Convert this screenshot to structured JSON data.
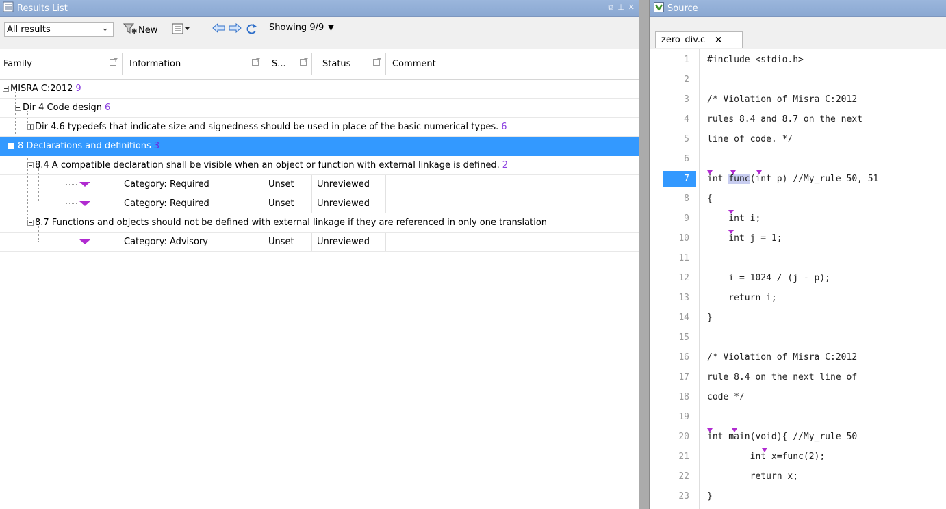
{
  "results_panel": {
    "title": "Results List",
    "window_controls": [
      "restore-icon",
      "pin-icon",
      "close-icon"
    ],
    "toolbar": {
      "filter_select_value": "All results",
      "new_label": "New",
      "showing_label": "Showing 9/9"
    },
    "columns": [
      "Family",
      "Information",
      "S...",
      "Status",
      "Comment"
    ],
    "tree": {
      "root": {
        "label": "MISRA C:2012",
        "count": "9"
      },
      "dir4": {
        "label": "Dir 4 Code design",
        "count": "6"
      },
      "dir46": {
        "label": "Dir 4.6 typedefs that indicate size and signedness should be used in place of the basic numerical types.",
        "count": "6"
      },
      "rule8": {
        "label": "8 Declarations and definitions",
        "count": "3"
      },
      "rule84": {
        "label": "8.4 A compatible declaration shall be visible when an object or function with external linkage is defined.",
        "count": "2"
      },
      "rule87": {
        "label": "8.7 Functions and objects should not be defined with external linkage if they are referenced in only one translation"
      },
      "leaves": [
        {
          "information": "Category: Required",
          "severity": "Unset",
          "status": "Unreviewed"
        },
        {
          "information": "Category: Required",
          "severity": "Unset",
          "status": "Unreviewed"
        },
        {
          "information": "Category: Advisory",
          "severity": "Unset",
          "status": "Unreviewed"
        }
      ]
    }
  },
  "source_panel": {
    "title": "Source",
    "tab_label": "zero_div.c",
    "tab_close": "×",
    "active_line": "7",
    "lines": [
      {
        "num": "1",
        "text": "#include <stdio.h>"
      },
      {
        "num": "2",
        "text": ""
      },
      {
        "num": "3",
        "text": "/* Violation of Misra C:2012"
      },
      {
        "num": "4",
        "text": "rules 8.4 and 8.7 on the next"
      },
      {
        "num": "5",
        "text": "line of code. */"
      },
      {
        "num": "6",
        "text": ""
      },
      {
        "num": "7",
        "pre": "int ",
        "hl": "func",
        "post": "(int p) //My_rule 50, 51"
      },
      {
        "num": "8",
        "text": "{"
      },
      {
        "num": "9",
        "text": "    int i;"
      },
      {
        "num": "10",
        "text": "    int j = 1;"
      },
      {
        "num": "11",
        "text": ""
      },
      {
        "num": "12",
        "text": "    i = 1024 / (j - p);"
      },
      {
        "num": "13",
        "text": "    return i;"
      },
      {
        "num": "14",
        "text": "}"
      },
      {
        "num": "15",
        "text": ""
      },
      {
        "num": "16",
        "text": "/* Violation of Misra C:2012"
      },
      {
        "num": "17",
        "text": "rule 8.4 on the next line of"
      },
      {
        "num": "18",
        "text": "code */"
      },
      {
        "num": "19",
        "text": ""
      },
      {
        "num": "20",
        "text": "int main(void){ //My_rule 50"
      },
      {
        "num": "21",
        "text": "        int x=func(2);"
      },
      {
        "num": "22",
        "text": "        return x;"
      },
      {
        "num": "23",
        "text": "}"
      }
    ]
  },
  "colors": {
    "selection": "#3399ff",
    "count_text": "#8a3ee0",
    "defect_marker": "#b02bd0",
    "titlebar": "#8aa8d2"
  }
}
